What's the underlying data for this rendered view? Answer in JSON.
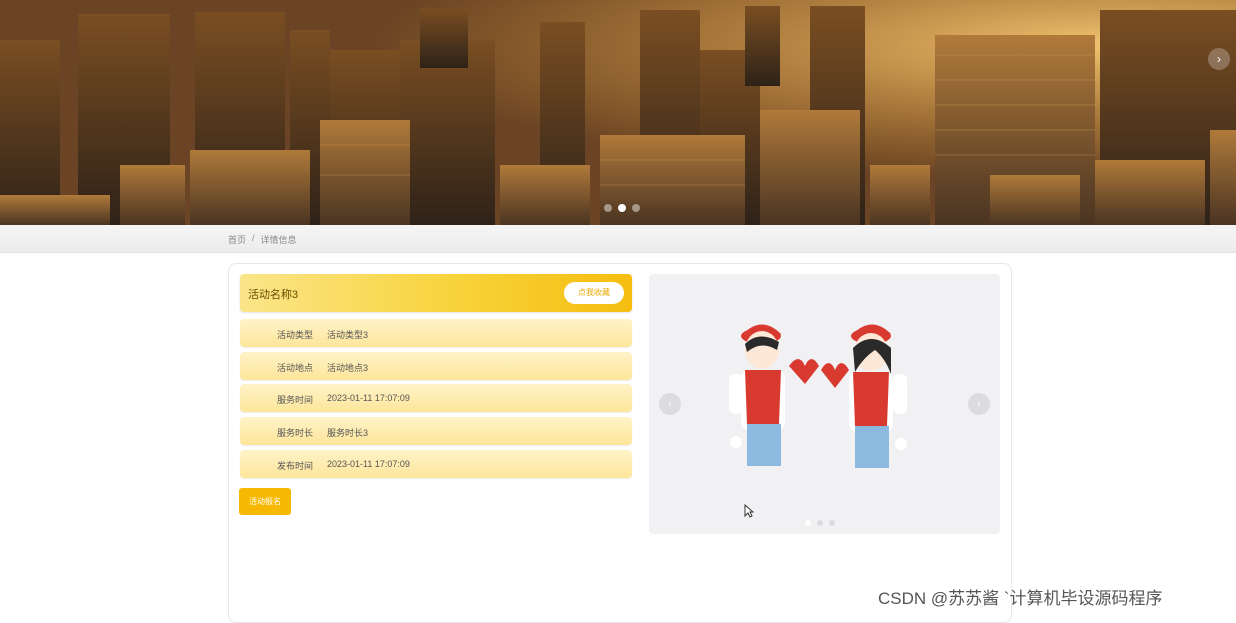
{
  "breadcrumb": {
    "home": "首页",
    "separator": "/",
    "current": "详情信息"
  },
  "detail": {
    "title": "活动名称3",
    "collect_label": "点我收藏",
    "fields": [
      {
        "label": "活动类型",
        "value": "活动类型3"
      },
      {
        "label": "活动地点",
        "value": "活动地点3"
      },
      {
        "label": "服务时间",
        "value": "2023-01-11 17:07:09"
      },
      {
        "label": "服务时长",
        "value": "服务时长3"
      },
      {
        "label": "发布时间",
        "value": "2023-01-11 17:07:09"
      }
    ],
    "signup_label": "活动报名"
  },
  "carousel": {
    "prev_icon": "‹",
    "next_icon": "›"
  },
  "banner": {
    "next_icon": "›"
  },
  "watermark": "CSDN @苏苏酱  `计算机毕设源码程序",
  "colors": {
    "accent": "#f6b800",
    "accent_light": "#fde59a"
  }
}
